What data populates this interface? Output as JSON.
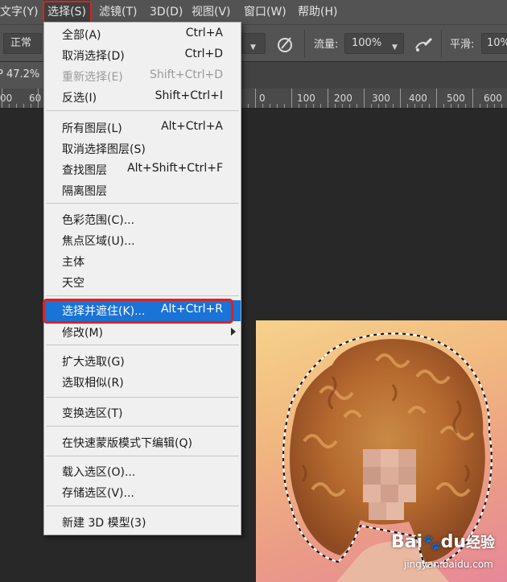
{
  "menubar": {
    "items": [
      "文字(Y)",
      "选择(S)",
      "滤镜(T)",
      "3D(D)",
      "视图(V)",
      "窗口(W)",
      "帮助(H)"
    ]
  },
  "options": {
    "mode": "正常",
    "flow_label": "流量:",
    "flow_value": "100%",
    "smooth_label": "平滑:",
    "smooth_value": "10%"
  },
  "document": {
    "zoom": "47.2%",
    "ruler_labels": [
      "00",
      "60",
      "0",
      "100",
      "200",
      "300",
      "400",
      "500",
      "600"
    ]
  },
  "menu": {
    "items": [
      {
        "label": "全部(A)",
        "shortcut": "Ctrl+A"
      },
      {
        "label": "取消选择(D)",
        "shortcut": "Ctrl+D"
      },
      {
        "label": "重新选择(E)",
        "shortcut": "Shift+Ctrl+D"
      },
      {
        "label": "反选(I)",
        "shortcut": "Shift+Ctrl+I"
      },
      {
        "label": "所有图层(L)",
        "shortcut": "Alt+Ctrl+A"
      },
      {
        "label": "取消选择图层(S)",
        "shortcut": ""
      },
      {
        "label": "查找图层",
        "shortcut": "Alt+Shift+Ctrl+F"
      },
      {
        "label": "隔离图层",
        "shortcut": ""
      },
      {
        "label": "色彩范围(C)...",
        "shortcut": ""
      },
      {
        "label": "焦点区域(U)...",
        "shortcut": ""
      },
      {
        "label": "主体",
        "shortcut": ""
      },
      {
        "label": "天空",
        "shortcut": ""
      },
      {
        "label": "选择并遮住(K)...",
        "shortcut": "Alt+Ctrl+R"
      },
      {
        "label": "修改(M)",
        "shortcut": ""
      },
      {
        "label": "扩大选取(G)",
        "shortcut": ""
      },
      {
        "label": "选取相似(R)",
        "shortcut": ""
      },
      {
        "label": "变换选区(T)",
        "shortcut": ""
      },
      {
        "label": "在快速蒙版模式下编辑(Q)",
        "shortcut": ""
      },
      {
        "label": "载入选区(O)...",
        "shortcut": ""
      },
      {
        "label": "存储选区(V)...",
        "shortcut": ""
      },
      {
        "label": "新建 3D 模型(3)",
        "shortcut": ""
      }
    ]
  },
  "watermark": {
    "brand": "Bai",
    "brand2": "du",
    "brand_cn": "经验",
    "url": "jingyan.baidu.com"
  },
  "colors": {
    "menu_highlight": "#1a73d6",
    "annotation": "#e0201f"
  }
}
